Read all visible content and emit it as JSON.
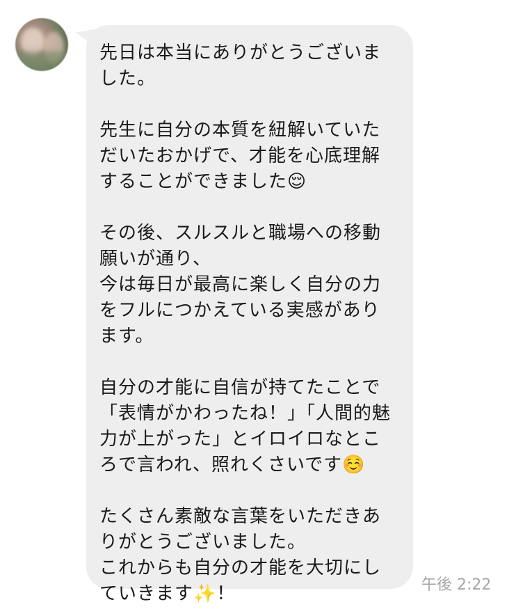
{
  "message": {
    "sender_avatar": "blurred-profile-photo",
    "text": "先日は本当にありがとうございました。\n\n先生に自分の本質を紐解いていただいたおかげで、才能を心底理解することができました😌\n\nその後、スルスルと職場への移動願いが通り、\n今は毎日が最高に楽しく自分の力をフルにつかえている実感があります。\n\n自分の才能に自信が持てたことで「表情がかわったね！」「人間的魅力が上がった」とイロイロなところで言われ、照れくさいです☺️\n\nたくさん素敵な言葉をいただきありがとうございました。\nこれからも自分の才能を大切にしていきます✨！",
    "timestamp": "午後 2:22"
  },
  "colors": {
    "bubble_background": "#eeeeee",
    "text": "#1a1a1a",
    "timestamp": "#a6a6a6"
  }
}
